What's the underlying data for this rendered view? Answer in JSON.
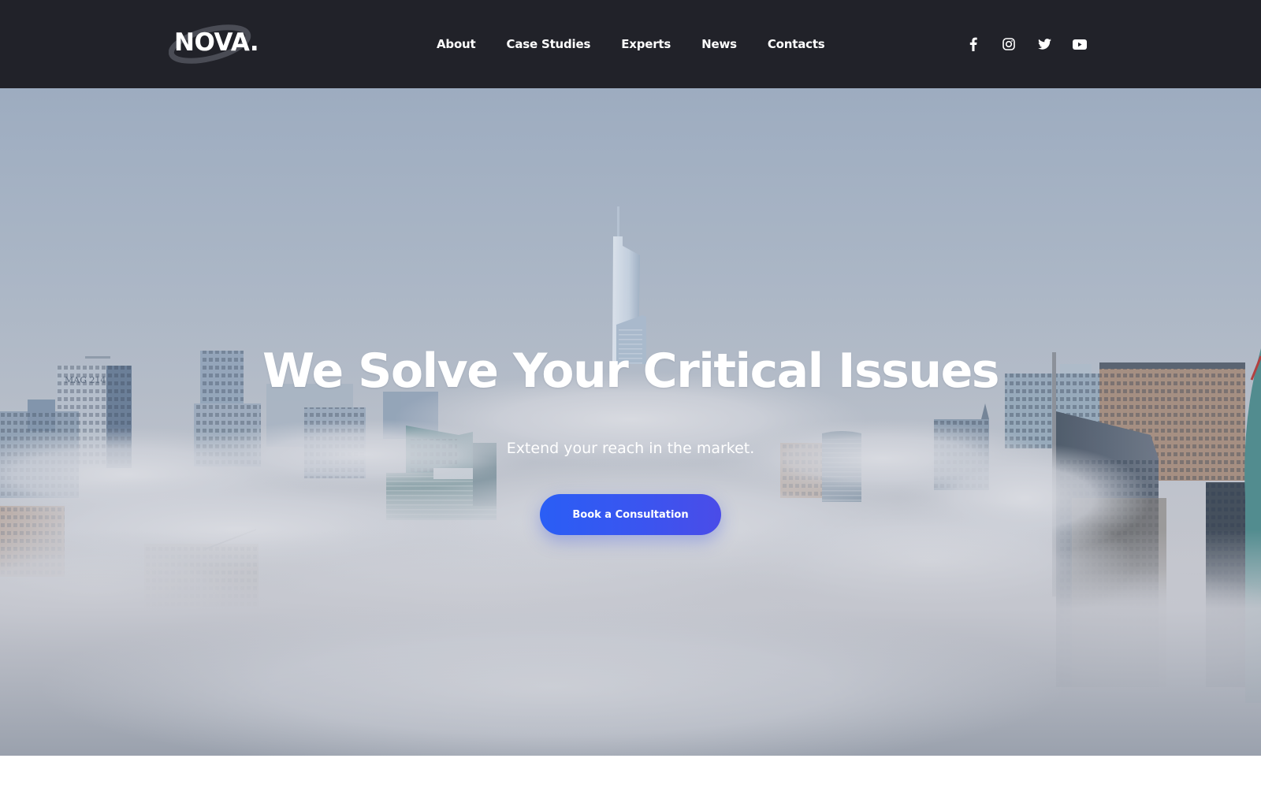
{
  "brand": {
    "name": "NOVA."
  },
  "nav": {
    "items": [
      {
        "label": "About"
      },
      {
        "label": "Case Studies"
      },
      {
        "label": "Experts"
      },
      {
        "label": "News"
      },
      {
        "label": "Contacts"
      }
    ]
  },
  "social": {
    "items": [
      {
        "name": "facebook",
        "icon": "facebook-icon"
      },
      {
        "name": "instagram",
        "icon": "instagram-icon"
      },
      {
        "name": "twitter",
        "icon": "twitter-icon"
      },
      {
        "name": "youtube",
        "icon": "youtube-icon"
      }
    ]
  },
  "hero": {
    "title": "We Solve Your Critical Issues",
    "subtitle": "Extend your reach in the market.",
    "cta_label": "Book a Consultation",
    "background": "foggy city skyline photo",
    "building_sign": "MAG 214"
  },
  "colors": {
    "header_bg": "#212229",
    "accent": "#3a55f0",
    "text_light": "#ffffff"
  }
}
